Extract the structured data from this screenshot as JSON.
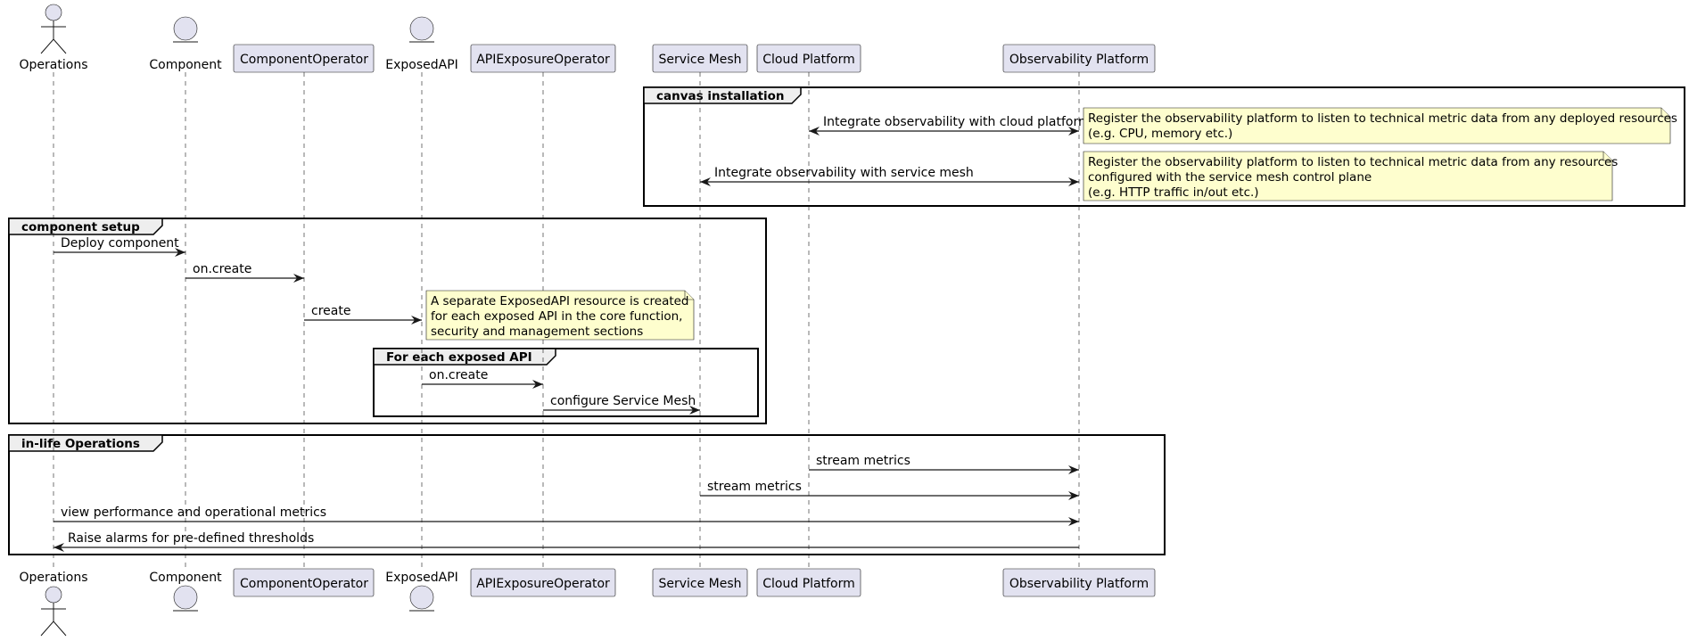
{
  "participants": [
    {
      "id": "ops",
      "name": "Operations",
      "type": "actor"
    },
    {
      "id": "comp",
      "name": "Component",
      "type": "entity"
    },
    {
      "id": "compop",
      "name": "ComponentOperator",
      "type": "participant"
    },
    {
      "id": "api",
      "name": "ExposedAPI",
      "type": "entity"
    },
    {
      "id": "apiop",
      "name": "APIExposureOperator",
      "type": "participant"
    },
    {
      "id": "mesh",
      "name": "Service Mesh",
      "type": "participant"
    },
    {
      "id": "cloud",
      "name": "Cloud Platform",
      "type": "participant"
    },
    {
      "id": "obs",
      "name": "Observability Platform",
      "type": "participant"
    }
  ],
  "frames": [
    {
      "id": "canvas",
      "title": "canvas installation"
    },
    {
      "id": "setup",
      "title": "component setup"
    },
    {
      "id": "each",
      "title": "For each exposed API"
    },
    {
      "id": "inlife",
      "title": "in-life Operations"
    }
  ],
  "messages": [
    {
      "from": "cloud",
      "to": "obs",
      "label": "Integrate observability with cloud platform",
      "bidirectional": true
    },
    {
      "from": "mesh",
      "to": "obs",
      "label": "Integrate observability with service mesh",
      "bidirectional": true
    },
    {
      "from": "ops",
      "to": "comp",
      "label": "Deploy component"
    },
    {
      "from": "comp",
      "to": "compop",
      "label": "on.create"
    },
    {
      "from": "compop",
      "to": "api",
      "label": "create"
    },
    {
      "from": "api",
      "to": "apiop",
      "label": "on.create"
    },
    {
      "from": "apiop",
      "to": "mesh",
      "label": "configure Service Mesh"
    },
    {
      "from": "cloud",
      "to": "obs",
      "label": "stream metrics"
    },
    {
      "from": "mesh",
      "to": "obs",
      "label": "stream metrics"
    },
    {
      "from": "ops",
      "to": "obs",
      "label": "view performance and operational metrics"
    },
    {
      "from": "obs",
      "to": "ops",
      "label": "Raise alarms for pre-defined thresholds"
    }
  ],
  "notes": [
    {
      "lines": [
        "Register the observability platform to listen to technical metric data from any deployed resources",
        "(e.g. CPU, memory etc.)"
      ]
    },
    {
      "lines": [
        "Register the observability platform to listen to technical metric data from any resources",
        "configured with the service mesh control plane",
        "(e.g. HTTP traffic in/out etc.)"
      ]
    },
    {
      "lines": [
        "A separate ExposedAPI resource is created",
        "for each exposed API in the core function,",
        "security and management sections"
      ]
    }
  ]
}
